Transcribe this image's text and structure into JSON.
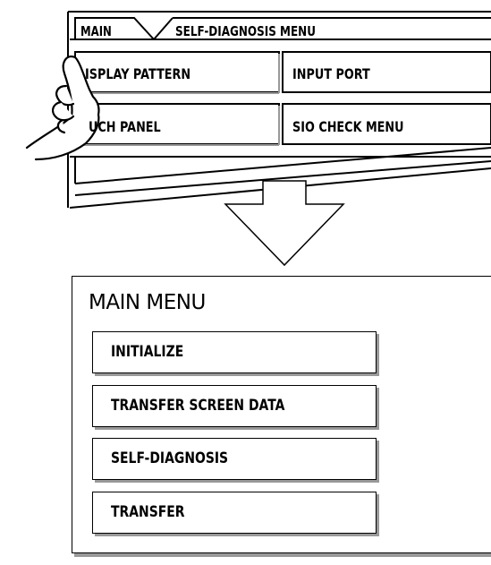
{
  "self_diagnosis_panel": {
    "tabs": {
      "main_label": "MAIN",
      "current_label": "SELF-DIAGNOSIS MENU"
    },
    "buttons": {
      "display_pattern": "ISPLAY PATTERN",
      "input_port": "INPUT PORT",
      "touch_panel": "UCH PANEL",
      "sio_check_menu": "SIO CHECK MENU"
    }
  },
  "main_menu_panel": {
    "title": "MAIN MENU",
    "items": [
      {
        "label": "INITIALIZE"
      },
      {
        "label": "TRANSFER SCREEN DATA"
      },
      {
        "label": "SELF-DIAGNOSIS"
      },
      {
        "label": "TRANSFER"
      }
    ]
  },
  "colors": {
    "line": "#000000",
    "shadow": "#999999",
    "background": "#ffffff"
  },
  "icons": [
    "pointing-hand-icon",
    "down-arrow-icon"
  ]
}
